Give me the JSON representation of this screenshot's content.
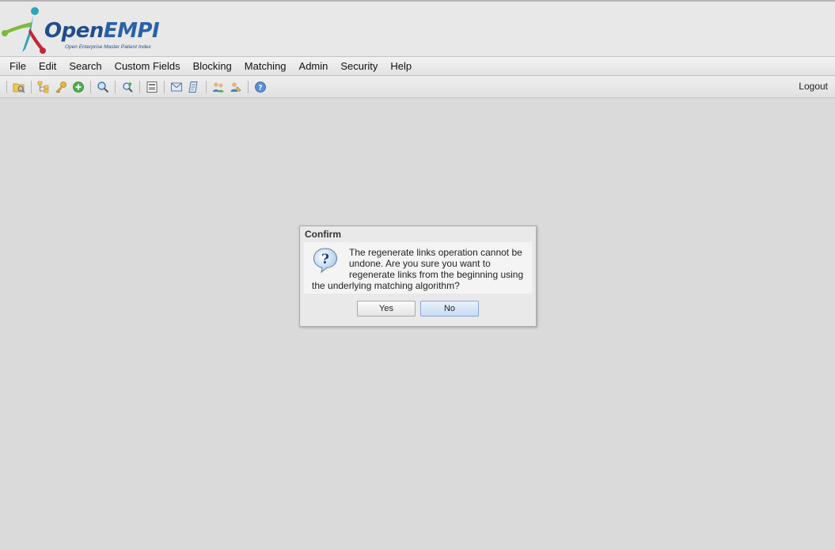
{
  "header": {
    "logo_text_open": "Open",
    "logo_text_empi": "EMPI",
    "logo_subtitle": "Open Enterprise Master Patient Index",
    "colors": {
      "brand_blue": "#1f4e8c",
      "teal": "#2aa5b8",
      "green": "#7cbb3a",
      "red": "#c0283a"
    }
  },
  "menu": {
    "items": [
      {
        "label": "File"
      },
      {
        "label": "Edit"
      },
      {
        "label": "Search"
      },
      {
        "label": "Custom Fields"
      },
      {
        "label": "Blocking"
      },
      {
        "label": "Matching"
      },
      {
        "label": "Admin"
      },
      {
        "label": "Security"
      },
      {
        "label": "Help"
      }
    ]
  },
  "toolbar": {
    "icons": [
      "open-folder-icon",
      "hierarchy-icon",
      "key-icon",
      "add-icon",
      "search-icon",
      "advanced-search-icon",
      "report-icon",
      "mail-icon",
      "document-icon",
      "users-icon",
      "user-edit-icon",
      "help-icon"
    ],
    "logout_label": "Logout"
  },
  "dialog": {
    "title": "Confirm",
    "icon": "question-icon",
    "message": "The regenerate links operation cannot be undone. Are you sure you want to regenerate links from the beginning using the underlying matching algorithm?",
    "yes_label": "Yes",
    "no_label": "No"
  }
}
